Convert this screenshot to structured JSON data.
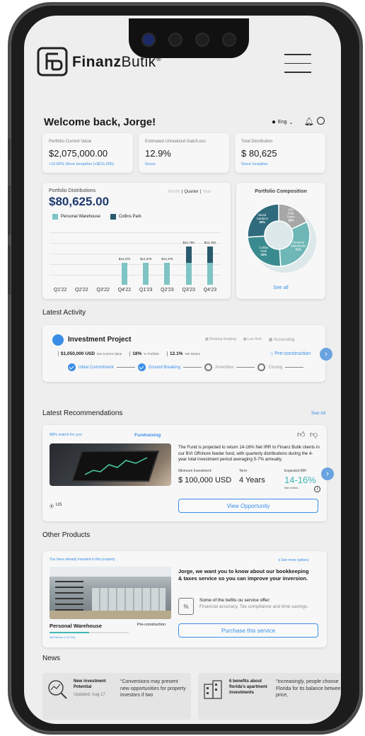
{
  "brand": {
    "name_bold": "Finanz",
    "name_light": "Butik",
    "reg": "®"
  },
  "header": {
    "welcome": "Welcome back, Jorge!",
    "language": "Eng"
  },
  "stats": [
    {
      "label": "Portfolio Current Value",
      "value": "$2,075,000.00",
      "sub": "+10.82% Since Inception (+$211,000)"
    },
    {
      "label": "Estimated Unrealized Gain/Loss",
      "value": "12.9%",
      "sub": "Gross"
    },
    {
      "label": "Total Distribution",
      "value": "$ 80,625",
      "sub": "Since Inception"
    }
  ],
  "distributions": {
    "title": "Portfolio Distributions",
    "amount": "$80,625.00",
    "periods": {
      "month": "Month",
      "quarter": "Quarter",
      "year": "Year",
      "sep": "|"
    },
    "legend": [
      "Personal Warehouse",
      "Collins Park"
    ]
  },
  "chart_data": {
    "type": "bar",
    "stacked": true,
    "categories": [
      "Q1'22",
      "Q2'22",
      "Q3'22",
      "Q4'22",
      "Q1'23",
      "Q2'23",
      "Q3'23",
      "Q4'23"
    ],
    "series": [
      {
        "name": "Personal Warehouse",
        "values": [
          0,
          0,
          0,
          12375,
          12375,
          12375,
          12375,
          12375
        ]
      },
      {
        "name": "Collins Park",
        "values": [
          0,
          0,
          0,
          0,
          0,
          0,
          9375,
          9375
        ]
      }
    ],
    "data_labels": [
      "",
      "",
      "",
      "$12,375",
      "$12,375",
      "$12,375",
      "$21,750",
      "$21,750"
    ],
    "ylim": [
      0,
      30000
    ],
    "grid": true,
    "colors": {
      "Personal Warehouse": "#7fc4c4",
      "Collins Park": "#2a5a6e"
    }
  },
  "composition": {
    "title": "Portfolio Composition",
    "see_all": "See all",
    "slices": [
      {
        "label": "Chic Park Tower",
        "pct": "18%",
        "value": 18,
        "color": "#a7a7a7"
      },
      {
        "label": "Personal Warehouse",
        "pct": "31%",
        "value": 31,
        "color": "#6fb6b6"
      },
      {
        "label": "Collins Park",
        "pct": "25%",
        "value": 25,
        "color": "#3a8b8f"
      },
      {
        "label": "Island Gardens",
        "pct": "26%",
        "value": 26,
        "color": "#2f6b7c"
      }
    ]
  },
  "activity": {
    "title": "Latest Activity",
    "project": "Investment Project",
    "tags": [
      "Booking Keeping",
      "Lux Host",
      "Accounting"
    ],
    "current_value": "$1,050,000 USD",
    "current_value_label": "Est.Current Value",
    "portfolio_pct": "18%",
    "portfolio_label": "% Portfolio",
    "net_return": "12.1%",
    "net_return_label": "Net Return",
    "stage": "Pre-construction",
    "steps": [
      "Initial Commitment",
      "Ground Breaking",
      "Amenities",
      "Closing"
    ]
  },
  "recommendations": {
    "title": "Latest Recommendations",
    "see_all": "See All",
    "match": "88% match for you",
    "status": "Fundraising",
    "description": "The Fund is projected to return 14-16% Net IRR to Finanz Butik clients in our BVI Offshore feeder fund, with quarterly distributions during the 4-year total investment period averaging 5-7% annually.",
    "min_label": "Minimum Investment:",
    "min_value": "$ 100,000 USD",
    "term_label": "Term",
    "term_value": "4 Years",
    "irr_label": "Expected IRR",
    "irr_value": "14-16%",
    "irr_note": "Net of fees",
    "location": "US",
    "cta": "View Opportunity"
  },
  "other_products": {
    "title": "Other Products",
    "invested_note": "You have already invested in this property",
    "see_more": "See more options",
    "property": "Personal Warehouse",
    "property_stage": "Pre-construction",
    "net_return": "Net Return (+11.3%)",
    "pitch": "Jorge, we want you to know about our bookkeeping & taxes service so you can improve your inversion.",
    "offer_title": "Some of the befits ou service offer:",
    "offer_items": "Financial accuracy, Tax compliance and time savings.",
    "cta": "Purchase this service"
  },
  "news": {
    "title": "News",
    "items": [
      {
        "title": "New investment Potential",
        "date": "Updated: Aug 17",
        "quote": "“Conversions may present new opportunities for property investors if two"
      },
      {
        "title": "6 benefits about florida's apartment investments",
        "date": "",
        "quote": "“Increasingly, people choose Florida for its balance between price,"
      }
    ]
  }
}
